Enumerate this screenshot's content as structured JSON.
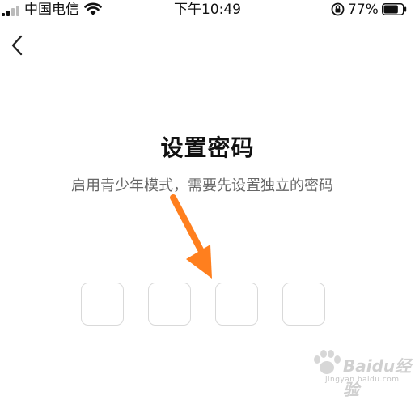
{
  "status_bar": {
    "carrier": "中国电信",
    "time": "下午10:49",
    "battery_percent": "77%",
    "battery_level": 0.77,
    "icons": [
      "signal-icon",
      "wifi-icon",
      "rotation-lock-icon",
      "battery-icon"
    ]
  },
  "nav": {
    "back_icon": "chevron-left-icon"
  },
  "main": {
    "title": "设置密码",
    "subtitle": "启用青少年模式，需要先设置独立的密码",
    "pin_length": 4,
    "pin_values": [
      "",
      "",
      "",
      ""
    ]
  },
  "overlay": {
    "arrow_color": "#FF7F1E",
    "watermark_text": "Baidu经验",
    "watermark_url": "jingyan.baidu.com"
  }
}
